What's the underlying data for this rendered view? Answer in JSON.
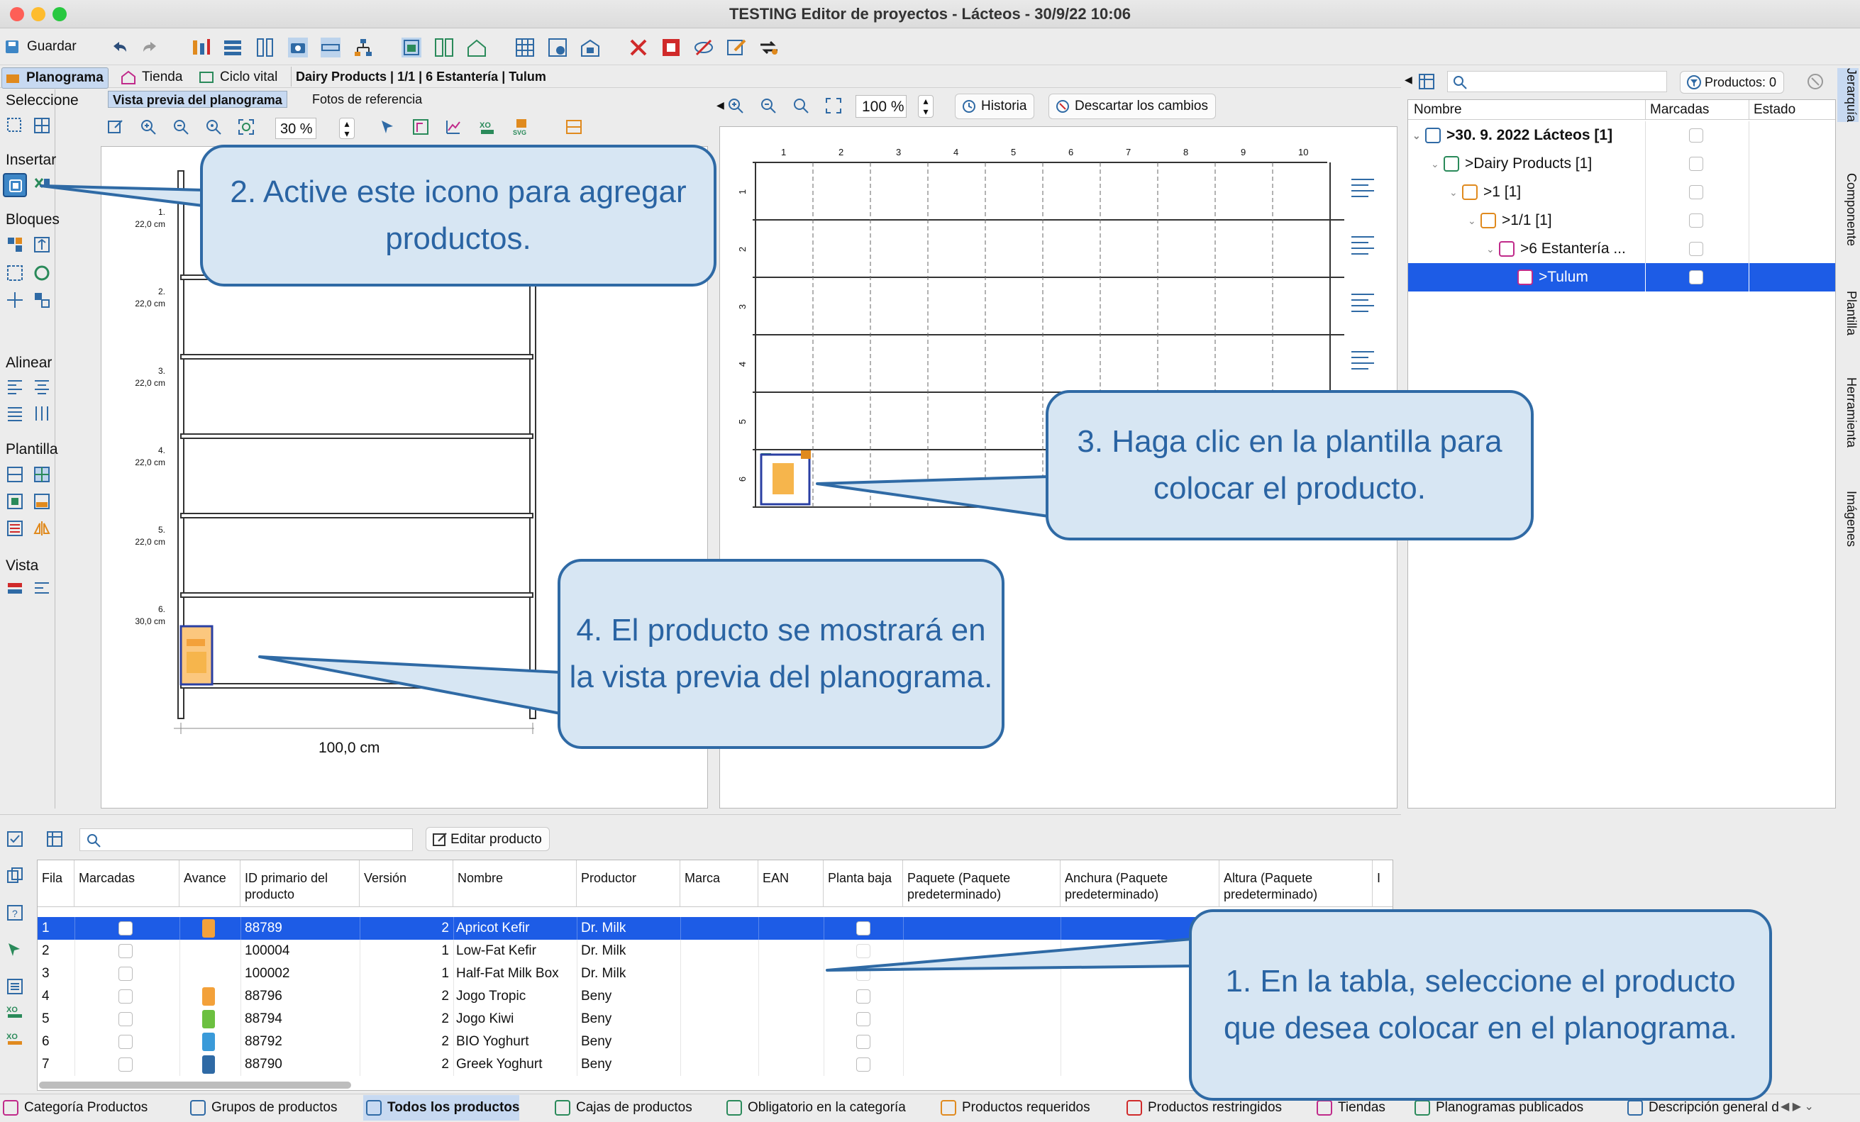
{
  "window": {
    "title": "TESTING Editor de proyectos - Lácteos - 30/9/22 10:06"
  },
  "toolbar": {
    "save_label": "Guardar"
  },
  "tabs": {
    "planograma": "Planograma",
    "tienda": "Tienda",
    "ciclo": "Ciclo vital",
    "path": "Dairy Products | 1/1 | 6 Estantería | Tulum"
  },
  "left": {
    "subtab_preview": "Vista previa del planograma",
    "subtab_photos": "Fotos de referencia",
    "zoom": "30 %"
  },
  "palette": {
    "seleccione": "Seleccione",
    "insertar": "Insertar",
    "bloques": "Bloques",
    "alinear": "Alinear",
    "plantilla": "Plantilla",
    "vista": "Vista"
  },
  "preview": {
    "shelves": [
      {
        "n": "1.",
        "h": "22,0 cm"
      },
      {
        "n": "2.",
        "h": "22,0 cm"
      },
      {
        "n": "3.",
        "h": "22,0 cm"
      },
      {
        "n": "4.",
        "h": "22,0 cm"
      },
      {
        "n": "5.",
        "h": "22,0 cm"
      },
      {
        "n": "6.",
        "h": "30,0 cm"
      }
    ],
    "width_label": "100,0 cm"
  },
  "editor": {
    "zoom": "100 %",
    "historia": "Historia",
    "descartar": "Descartar los cambios",
    "cols": [
      "1",
      "2",
      "3",
      "4",
      "5",
      "6",
      "7",
      "8",
      "9",
      "10"
    ],
    "rows": [
      "1",
      "2",
      "3",
      "4",
      "5",
      "6"
    ]
  },
  "right": {
    "productos": "Productos: 0",
    "headers": {
      "nombre": "Nombre",
      "marcadas": "Marcadas",
      "estado": "Estado"
    },
    "tree": [
      {
        "label": ">30. 9. 2022 Lácteos [1]",
        "bold": true
      },
      {
        "label": ">Dairy Products [1]"
      },
      {
        "label": ">1 [1]"
      },
      {
        "label": ">1/1 [1]"
      },
      {
        "label": ">6 Estantería ..."
      },
      {
        "label": ">Tulum"
      }
    ],
    "vtabs": [
      "Jerarquía",
      "Componente",
      "Plantilla",
      "Herramienta",
      "Imágenes"
    ]
  },
  "table": {
    "edit_button": "Editar producto",
    "headers": [
      "Fila",
      "Marcadas",
      "Avance",
      "ID primario del producto",
      "Versión",
      "Nombre",
      "Productor",
      "Marca",
      "EAN",
      "Planta baja",
      "Paquete (Paquete predeterminado)",
      "Anchura (Paquete predeterminado)",
      "Altura (Paquete predeterminado)",
      "I"
    ],
    "rows": [
      {
        "fila": "1",
        "id": "88789",
        "ver": "2",
        "nombre": "Apricot Kefir",
        "prod": "Dr. Milk",
        "anch": "9"
      },
      {
        "fila": "2",
        "id": "100004",
        "ver": "1",
        "nombre": "Low-Fat Kefir",
        "prod": "Dr. Milk",
        "anch": ""
      },
      {
        "fila": "3",
        "id": "100002",
        "ver": "1",
        "nombre": "Half-Fat Milk Box",
        "prod": "Dr. Milk",
        "anch": ""
      },
      {
        "fila": "4",
        "id": "88796",
        "ver": "2",
        "nombre": "Jogo Tropic",
        "prod": "Beny",
        "anch": "5"
      },
      {
        "fila": "5",
        "id": "88794",
        "ver": "2",
        "nombre": "Jogo Kiwi",
        "prod": "Beny",
        "anch": "5"
      },
      {
        "fila": "6",
        "id": "88792",
        "ver": "2",
        "nombre": "BIO Yoghurt",
        "prod": "Beny",
        "anch": "5"
      },
      {
        "fila": "7",
        "id": "88790",
        "ver": "2",
        "nombre": "Greek Yoghurt",
        "prod": "Beny",
        "anch": "5"
      }
    ]
  },
  "bottom_tabs": [
    "Categoría Productos",
    "Grupos de productos",
    "Todos los productos",
    "Cajas de productos",
    "Obligatorio en la categoría",
    "Productos requeridos",
    "Productos restringidos",
    "Tiendas",
    "Planogramas publicados",
    "Descripción general d"
  ],
  "callouts": {
    "c1": "1. En la tabla, seleccione el producto que desea colocar en el planograma.",
    "c2": "2. Active este icono para agregar productos.",
    "c3": "3. Haga clic en la plantilla para colocar el producto.",
    "c4": "4. El producto se mostrará en la vista previa del planograma."
  },
  "colors": {
    "accent": "#1d5ce6",
    "callout_fill": "#d7e6f3",
    "callout_border": "#2f6aa5"
  }
}
